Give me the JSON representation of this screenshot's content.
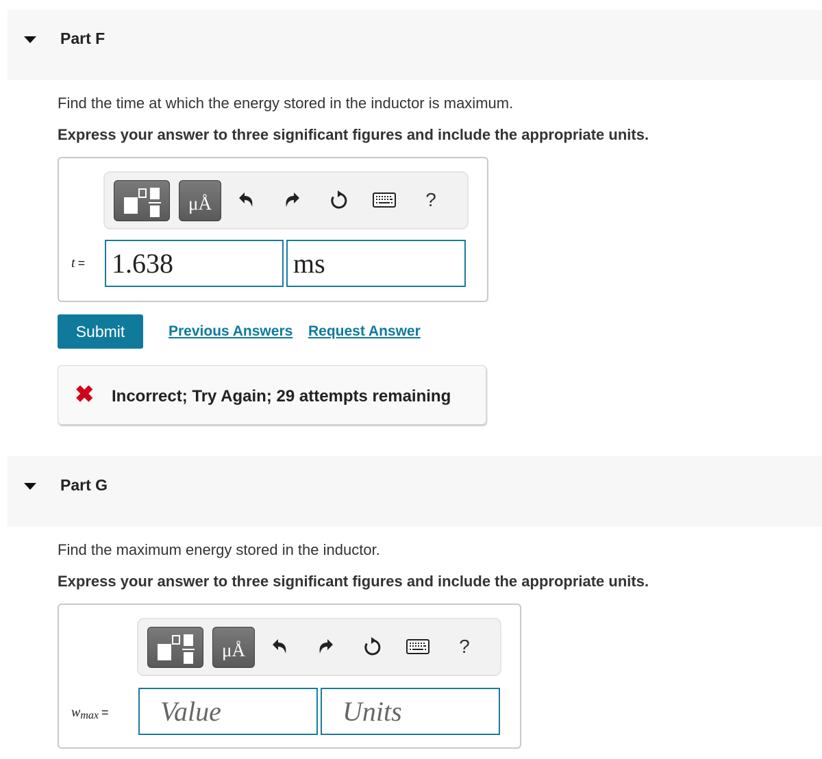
{
  "parts": [
    {
      "title": "Part F",
      "prompt": "Find the time at which the energy stored in the inductor is maximum.",
      "instruction": "Express your answer to three significant figures and include the appropriate units.",
      "toolbar": {
        "templates_icon": "templates-icon",
        "units_label": "μÅ",
        "undo_icon": "undo-icon",
        "redo_icon": "redo-icon",
        "reset_icon": "reset-icon",
        "keyboard_icon": "keyboard-icon",
        "help_label": "?"
      },
      "variable": "t",
      "equals": "=",
      "value": "1.638",
      "units": "ms",
      "submit_label": "Submit",
      "previous_answers_label": "Previous Answers",
      "request_answer_label": "Request Answer",
      "feedback": {
        "icon": "x-icon",
        "symbol": "✖",
        "message": "Incorrect; Try Again; 29 attempts remaining",
        "color": "#d0021b"
      }
    },
    {
      "title": "Part G",
      "prompt": "Find the maximum energy stored in the inductor.",
      "instruction": "Express your answer to three significant figures and include the appropriate units.",
      "toolbar": {
        "templates_icon": "templates-icon",
        "units_label": "μÅ",
        "undo_icon": "undo-icon",
        "redo_icon": "redo-icon",
        "reset_icon": "reset-icon",
        "keyboard_icon": "keyboard-icon",
        "help_label": "?"
      },
      "variable": "w",
      "variable_sub": "max",
      "equals": "=",
      "value_placeholder": "Value",
      "units_placeholder": "Units"
    }
  ],
  "colors": {
    "accent": "#0f7a9c",
    "field_border": "#1a7a9e",
    "error": "#d0021b",
    "header_bg": "#f7f7f7"
  }
}
